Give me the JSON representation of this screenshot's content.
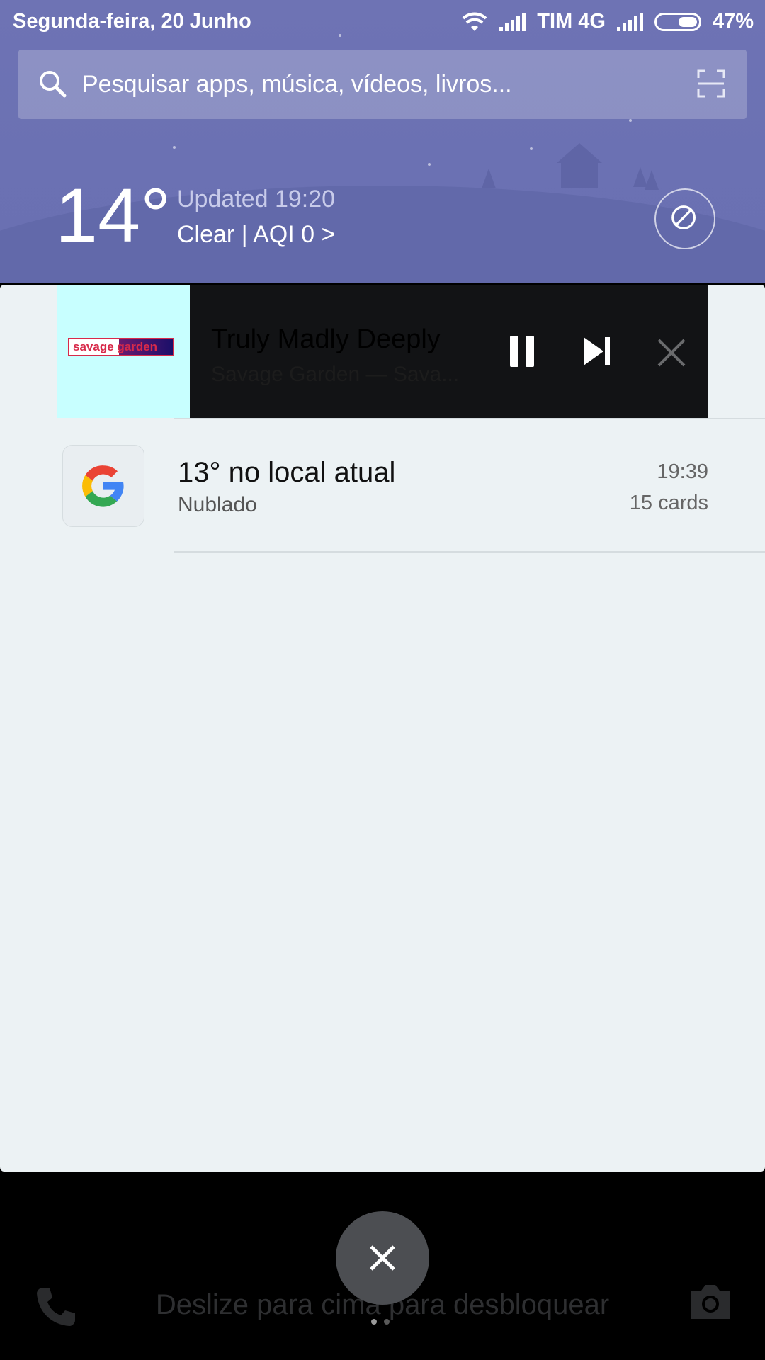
{
  "status_bar": {
    "date": "Segunda-feira, 20 Junho",
    "carrier": "TIM 4G",
    "battery": "47%"
  },
  "search": {
    "placeholder": "Pesquisar apps, música, vídeos, livros..."
  },
  "weather": {
    "temperature": "14°",
    "updated": "Updated 19:20",
    "condition": "Clear | AQI 0 >"
  },
  "media": {
    "album_label": "savage garden",
    "title": "Truly Madly Deeply",
    "artist": "Savage Garden — Sava..."
  },
  "notification": {
    "title": "13° no local atual",
    "subtitle": "Nublado",
    "time": "19:39",
    "cards": "15 cards"
  },
  "lockscreen": {
    "unlock_hint": "Deslize para cima para desbloquear"
  },
  "icons": {
    "phone": "phone-icon",
    "camera": "camera-icon",
    "clear": "close-icon"
  },
  "colors": {
    "header": "#6e73b4",
    "panel": "#ecf2f4",
    "media_bg": "#121315"
  }
}
